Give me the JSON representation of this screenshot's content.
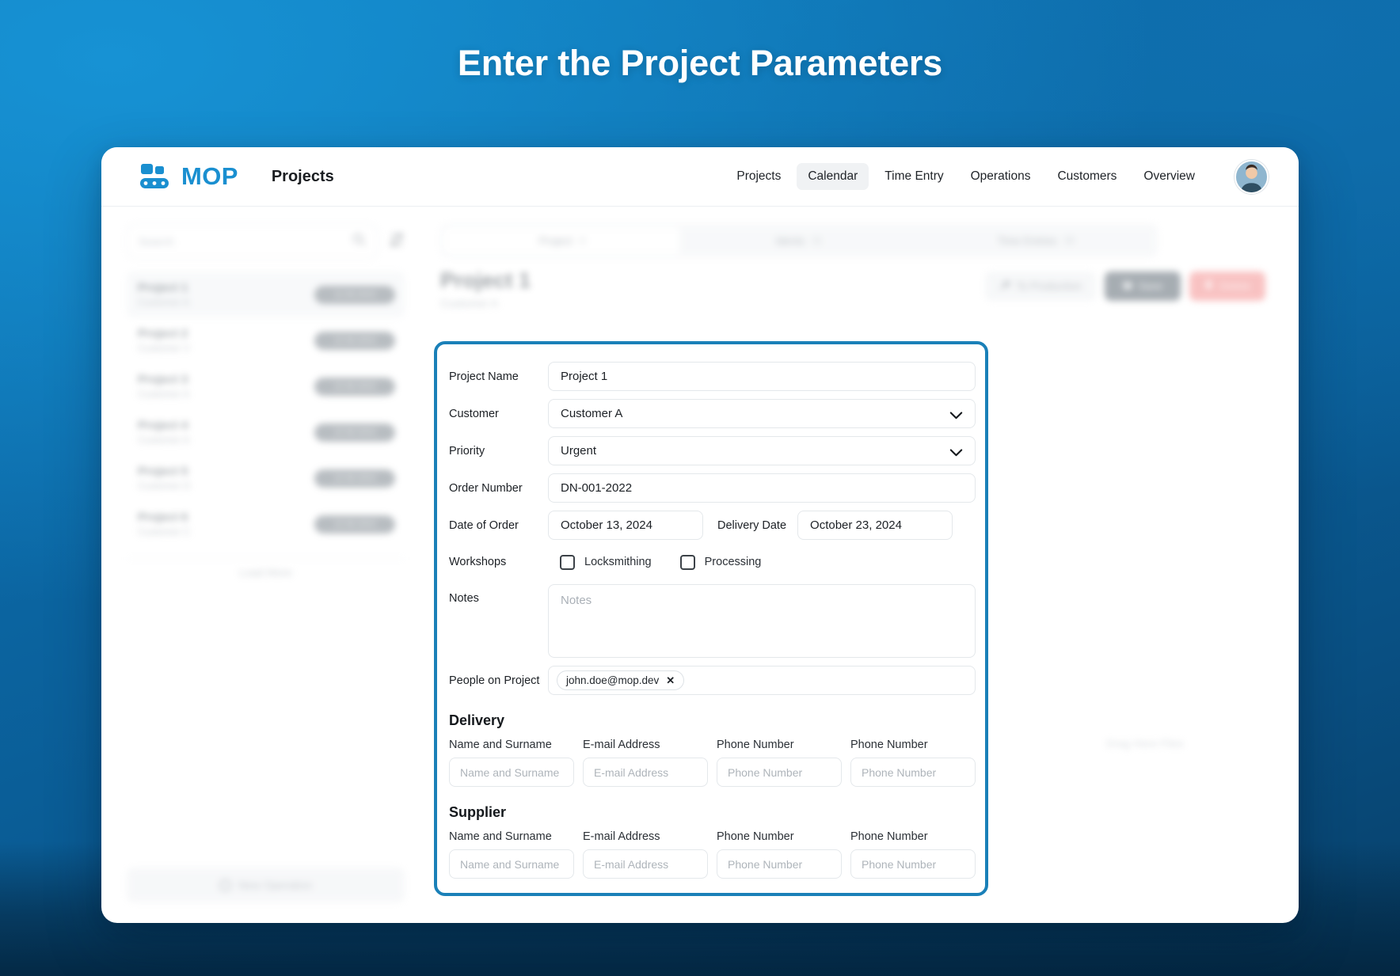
{
  "headline": "Enter the Project Parameters",
  "brand": {
    "name": "MOP",
    "page_label": "Projects",
    "logo_icon": "conveyor-belt-icon"
  },
  "nav": {
    "items": [
      {
        "label": "Projects",
        "active": false
      },
      {
        "label": "Calendar",
        "active": true
      },
      {
        "label": "Time Entry",
        "active": false
      },
      {
        "label": "Operations",
        "active": false
      },
      {
        "label": "Customers",
        "active": false
      },
      {
        "label": "Overview",
        "active": false
      }
    ],
    "avatar_name": "user-avatar"
  },
  "sidebar": {
    "search_placeholder": "Search",
    "search_icon": "magnifier-icon",
    "sort_icon": "sort-icon",
    "projects": [
      {
        "title": "Project 1",
        "customer": "Customer A",
        "date": "12.06.2023",
        "selected": true
      },
      {
        "title": "Project 2",
        "customer": "Customer V",
        "date": "12.06.2023",
        "selected": false
      },
      {
        "title": "Project 3",
        "customer": "Customer A",
        "date": "12.06.2023",
        "selected": false
      },
      {
        "title": "Project 4",
        "customer": "Customer A",
        "date": "12.06.2023",
        "selected": false
      },
      {
        "title": "Project 5",
        "customer": "Customer D",
        "date": "12.06.2023",
        "selected": false
      },
      {
        "title": "Project 6",
        "customer": "Customer C",
        "date": "12.06.2023",
        "selected": false
      }
    ],
    "load_more_label": "Load More",
    "new_operation_label": "New Operation",
    "new_operation_icon": "plus-circle-icon"
  },
  "main": {
    "tabs": [
      {
        "label": "Project",
        "count": "4",
        "active": true
      },
      {
        "label": "Idents",
        "count": "31",
        "active": false
      },
      {
        "label": "Time Entries",
        "count": "30",
        "active": false
      }
    ],
    "project_title": "Project 1",
    "project_customer": "Customer A",
    "actions": {
      "to_production": "To Production",
      "to_production_icon": "wrench-icon",
      "save": "Save",
      "save_icon": "save-icon",
      "delete": "Delete",
      "delete_icon": "trash-icon"
    },
    "ghost_text": "Drag Here Files"
  },
  "form": {
    "project_name": {
      "label": "Project Name",
      "value": "Project 1"
    },
    "customer": {
      "label": "Customer",
      "value": "Customer A",
      "icon": "chevron-down-icon"
    },
    "priority": {
      "label": "Priority",
      "value": "Urgent",
      "icon": "chevron-down-icon"
    },
    "order_number": {
      "label": "Order Number",
      "value": "DN-001-2022"
    },
    "date_of_order": {
      "label": "Date of Order",
      "value": "October 13, 2024"
    },
    "delivery_date": {
      "label": "Delivery Date",
      "value": "October 23, 2024"
    },
    "workshops": {
      "label": "Workshops",
      "options": [
        {
          "label": "Locksmithing",
          "checked": false
        },
        {
          "label": "Processing",
          "checked": false
        }
      ]
    },
    "notes": {
      "label": "Notes",
      "placeholder": "Notes",
      "value": ""
    },
    "people_on_project": {
      "label": "People on Project",
      "chips": [
        {
          "text": "john.doe@mop.dev",
          "remove_icon": "close-icon"
        }
      ]
    },
    "delivery": {
      "title": "Delivery",
      "columns": [
        "Name and Surname",
        "E-mail Address",
        "Phone Number",
        "Phone Number"
      ],
      "placeholders": [
        "Name and Surname",
        "E-mail Address",
        "Phone Number",
        "Phone Number"
      ]
    },
    "supplier": {
      "title": "Supplier",
      "columns": [
        "Name and Surname",
        "E-mail Address",
        "Phone Number",
        "Phone Number"
      ],
      "placeholders": [
        "Name and Surname",
        "E-mail Address",
        "Phone Number",
        "Phone Number"
      ]
    }
  },
  "colors": {
    "brand_blue": "#1a8fd0",
    "highlight_border": "#1a80b8",
    "arrow": "#1a7fb5",
    "background_top": "#0e7cbd",
    "background_bottom": "#073f68",
    "delete_red": "#f59a9a"
  }
}
